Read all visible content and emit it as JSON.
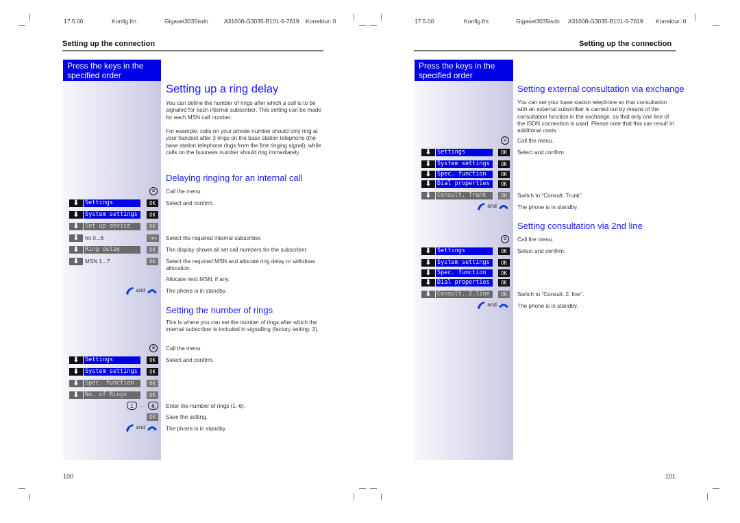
{
  "header": {
    "date": "17.5.00",
    "file": "Konfig.fm",
    "product": "Gigaset3035isdn",
    "doc_id": "A31008-G3035-B101-6-7619",
    "revision": "Korrektur: 0"
  },
  "left_page": {
    "section_title": "Setting up the connection",
    "side_box": "Press the keys in the specified order",
    "page_number": "100",
    "title": "Setting up a ring delay",
    "intro": [
      "You can define the number of rings after which a call is to be signaled for each internal subscriber. This setting can be made for each MSN call number.",
      "For example, calls on your private number should only ring at your handset after 3 rings on the base station telephone (the base station telephone rings from the first ringing signal), while calls on the business number should ring immediately."
    ],
    "sub1": {
      "title": "Delaying ringing for an internal call",
      "menu_text": "Call the menu.",
      "steps": [
        {
          "label": "Settings",
          "ok": "OK",
          "text": "Select and confirm."
        },
        {
          "label": "System settings",
          "ok": "OK",
          "text": ""
        },
        {
          "label": "Set up device",
          "ok": "OK",
          "text": ""
        },
        {
          "label": "Int 0...6",
          "ok": "‘≡+",
          "text": "Select the required internal subscriber."
        },
        {
          "label": "Ring delay",
          "ok": "OK",
          "text": "The display shows all set call numbers for the subscriber."
        },
        {
          "label": "MSN 1...7",
          "ok": "OK",
          "text": "Select the required MSN and allocate ring delay or withdraw allocation."
        }
      ],
      "extra_text": "Allocate next MSN, if any.",
      "and_label": "and",
      "standby_text": "The phone is in standby."
    },
    "sub2": {
      "title": "Setting the number of rings",
      "intro": "This is where you can set the number of rings after which the internal subscriber is included in signalling (factory setting: 3).",
      "menu_text": "Call the menu.",
      "steps": [
        {
          "label": "Settings",
          "ok": "OK",
          "text": "Select and confirm."
        },
        {
          "label": "System settings",
          "ok": "OK",
          "text": ""
        },
        {
          "label": "Spec. function",
          "ok": "OK",
          "text": ""
        },
        {
          "label": "No. of Rings",
          "ok": "OK",
          "text": ""
        }
      ],
      "keys": {
        "first": "1",
        "ellipsis": "...",
        "last": "6",
        "text": "Enter the number of rings (1–6)."
      },
      "save_ok": "OK",
      "save_text": "Save the setting.",
      "and_label": "and",
      "standby_text": "The phone is in standby."
    }
  },
  "right_page": {
    "section_title": "Setting up the connection",
    "side_box": "Press the keys in the specified order",
    "page_number": "101",
    "sub1": {
      "title": "Setting external consultation via exchange",
      "intro": "You can set your base station telephone so that consultation with an external subscriber is carried out by means of the consultation function in the exchange, so that only one line of the ISDN connection is used. Please note that this can result in additional costs.",
      "menu_text": "Call the menu.",
      "steps": [
        {
          "label": "Settings",
          "ok": "OK",
          "text": "Select and confirm."
        },
        {
          "label": "System settings",
          "ok": "OK",
          "text": ""
        },
        {
          "label": "Spec. function",
          "ok": "OK",
          "text": ""
        },
        {
          "label": "Dial properties",
          "ok": "OK",
          "text": ""
        },
        {
          "label": "Consult. Trunk",
          "ok": "OK",
          "text": "Switch to “Consult. Trunk”."
        }
      ],
      "and_label": "and",
      "standby_text": "The phone is in standby."
    },
    "sub2": {
      "title": "Setting consultation via 2nd line",
      "menu_text": "Call the menu.",
      "steps": [
        {
          "label": "Settings",
          "ok": "OK",
          "text": "Select and confirm."
        },
        {
          "label": "System settings",
          "ok": "OK",
          "text": ""
        },
        {
          "label": "Spec. function",
          "ok": "OK",
          "text": ""
        },
        {
          "label": "Dial properties",
          "ok": "OK",
          "text": ""
        },
        {
          "label": "Consult. 2.line",
          "ok": "OK",
          "text": "Switch to “Consult. 2. line”."
        }
      ],
      "and_label": "and",
      "standby_text": "The phone is in standby."
    }
  }
}
